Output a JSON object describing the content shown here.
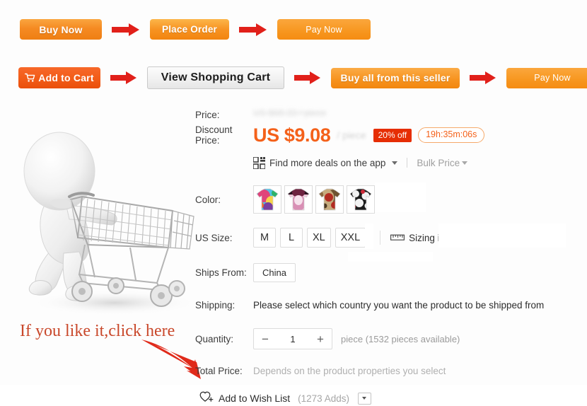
{
  "flow_row_1": [
    {
      "name": "buy-now",
      "label": "Buy Now"
    },
    {
      "name": "place-order",
      "label": "Place Order"
    },
    {
      "name": "pay-now",
      "label": "Pay Now"
    }
  ],
  "flow_row_2": [
    {
      "name": "add-to-cart",
      "label": "Add to Cart"
    },
    {
      "name": "view-shopping-cart",
      "label": "View Shopping Cart"
    },
    {
      "name": "buy-all-from-this-seller",
      "label": "Buy all from this seller"
    },
    {
      "name": "pay-now",
      "label": "Pay Now"
    }
  ],
  "annotation": {
    "text": "If you like it,click here",
    "color": "#c9482b"
  },
  "product": {
    "price_label": "Price:",
    "original_price": "US $68.33 / piece",
    "discount_price_label": "Discount Price:",
    "price": "US $9.08",
    "per_unit": "/ piece",
    "discount_badge": "20% off",
    "countdown": "19h:35m:06s",
    "app_deals_label": "Find more deals on the app",
    "bulk_price_label": "Bulk Price",
    "color_label": "Color:",
    "colors": [
      {
        "name": "skull-print-tee",
        "c1": "#4fc3e8",
        "c2": "#e0447a",
        "c3": "#f6d24a",
        "c4": "#7a3fa0"
      },
      {
        "name": "pink-purple-tee",
        "c1": "#f1c6da",
        "c2": "#6d2340",
        "c3": "#d98fb5",
        "c4": "#2a1420"
      },
      {
        "name": "brown-red-camo-tee",
        "c1": "#8d6a41",
        "c2": "#b32c22",
        "c3": "#c6ab7d",
        "c4": "#4d3a22"
      },
      {
        "name": "black-white-floral-tee",
        "c1": "#1c1c1c",
        "c2": "#f2f2f2",
        "c3": "#cf2b3a",
        "c4": "#8a8a8a"
      }
    ],
    "size_label": "US Size:",
    "sizes": [
      "M",
      "L",
      "XL",
      "XXL"
    ],
    "sizing_info_label": "Sizing info",
    "ships_from_label": "Ships From:",
    "ships_from_value": "China",
    "shipping_label": "Shipping:",
    "shipping_message": "Please select which country you want the product to be shipped from",
    "quantity_label": "Quantity:",
    "quantity_decrement": "−",
    "quantity_value": "1",
    "quantity_increment": "+",
    "quantity_note": "piece (1532 pieces available)",
    "total_price_label": "Total Price:",
    "total_price_note": "Depends on the product properties you select",
    "wish_list_label": "Add to Wish List",
    "wish_list_count": "(1273 Adds)"
  }
}
